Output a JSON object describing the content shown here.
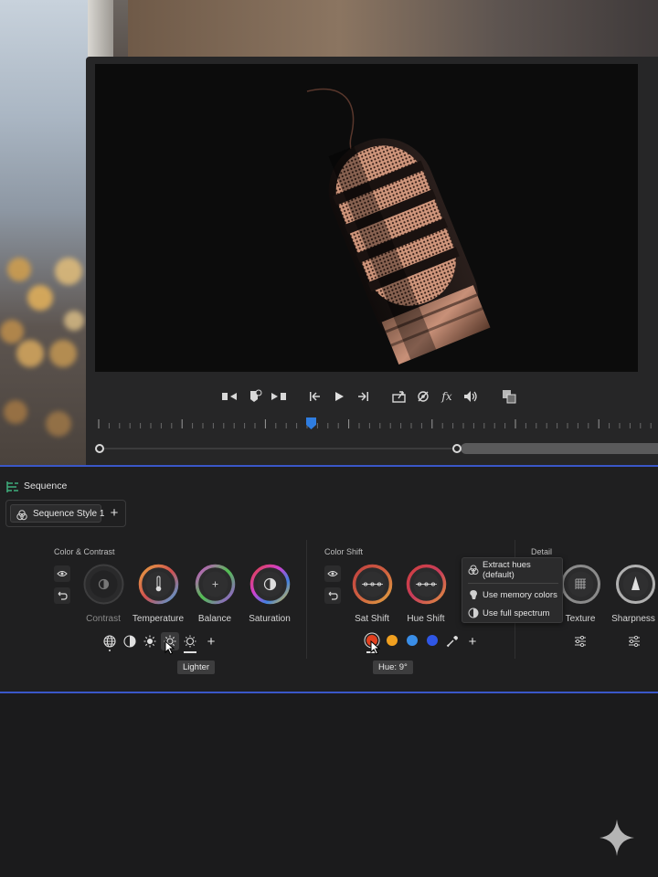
{
  "panel": {
    "title": "Sequence",
    "style_chip": "Sequence Style 1",
    "add_symbol": "+"
  },
  "sections": {
    "color_contrast": {
      "title": "Color & Contrast",
      "dials": [
        "Contrast",
        "Temperature",
        "Balance",
        "Saturation"
      ],
      "tooltip": "Lighter"
    },
    "color_shift": {
      "title": "Color Shift",
      "dials": [
        "Sat Shift",
        "Hue Shift"
      ],
      "tooltip": "Hue: 9°",
      "swatches": [
        "#e2401f",
        "#f0a020",
        "#3a8ee8",
        "#2f57e6"
      ]
    },
    "detail": {
      "title": "Detail",
      "dials": [
        "Texture",
        "Sharpness"
      ]
    }
  },
  "menu": {
    "items": [
      "Extract hues (default)",
      "Use memory colors",
      "Use full spectrum"
    ]
  },
  "transport": {
    "icons": [
      "mark-in-icon",
      "add-marker-icon",
      "mark-out-icon",
      "go-to-in-icon",
      "play-icon",
      "go-to-out-icon",
      "export-frame-icon",
      "settings-icon",
      "fx-icon",
      "volume-icon",
      "compare-view-icon"
    ],
    "fx_label": "fx"
  },
  "colors": {
    "accent": "#3a57c8",
    "playhead": "#2f7de0",
    "panel_bg": "#1f1f20"
  }
}
